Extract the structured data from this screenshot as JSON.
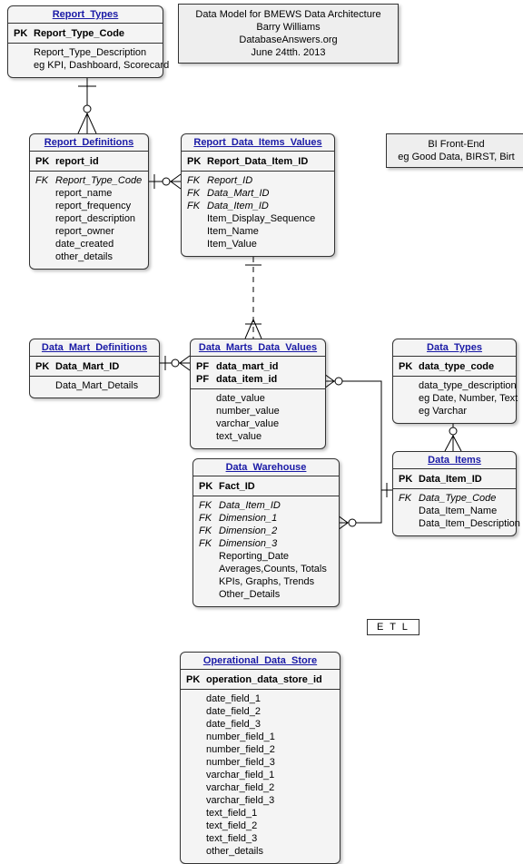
{
  "header_note": {
    "line1": "Data Model for BMEWS Data Architecture",
    "line2": "Barry Williams",
    "line3": "DatabaseAnswers.org",
    "line4": "June 24tth. 2013"
  },
  "side_note": {
    "line1": "BI Front-End",
    "line2": "eg Good Data, BIRST, Birt"
  },
  "etl_label": "E T L",
  "entities": {
    "report_types": {
      "title": "Report_Types",
      "pk": "Report_Type_Code",
      "f1": "Report_Type_Description",
      "f2": "eg KPI, Dashboard, Scorecard"
    },
    "report_definitions": {
      "title": "Report_Definitions",
      "pk": "report_id",
      "fk1": "Report_Type_Code",
      "f1": "report_name",
      "f2": "report_frequency",
      "f3": "report_description",
      "f4": "report_owner",
      "f5": "date_created",
      "f6": "other_details"
    },
    "report_data_items_values": {
      "title": "Report_Data_Items_Values",
      "pk": "Report_Data_Item_ID",
      "fk1": "Report_ID",
      "fk2": "Data_Mart_ID",
      "fk3": "Data_Item_ID",
      "f1": "Item_Display_Sequence",
      "f2": "Item_Name",
      "f3": "Item_Value"
    },
    "data_mart_definitions": {
      "title": "Data_Mart_Definitions",
      "pk": "Data_Mart_ID",
      "f1": "Data_Mart_Details"
    },
    "data_marts_data_values": {
      "title": "Data_Marts_Data_Values",
      "pf1": "data_mart_id",
      "pf2": "data_item_id",
      "f1": "date_value",
      "f2": "number_value",
      "f3": "varchar_value",
      "f4": "text_value"
    },
    "data_types": {
      "title": "Data_Types",
      "pk": "data_type_code",
      "f1": "data_type_description",
      "f2": "eg Date, Number, Text",
      "f3": "eg Varchar"
    },
    "data_items": {
      "title": "Data_Items",
      "pk": "Data_Item_ID",
      "fk1": "Data_Type_Code",
      "f1": "Data_Item_Name",
      "f2": "Data_Item_Description"
    },
    "data_warehouse": {
      "title": "Data_Warehouse",
      "pk": "Fact_ID",
      "fk1": "Data_Item_ID",
      "fk2": "Dimension_1",
      "fk3": "Dimension_2",
      "fk4": "Dimension_3",
      "f1": "Reporting_Date",
      "f2": "Averages,Counts, Totals",
      "f3": "KPIs, Graphs, Trends",
      "f4": "Other_Details"
    },
    "operational_data_store": {
      "title": "Operational_Data_Store",
      "pk": "operation_data_store_id",
      "f1": "date_field_1",
      "f2": "date_field_2",
      "f3": "date_field_3",
      "f4": "number_field_1",
      "f5": "number_field_2",
      "f6": "number_field_3",
      "f7": "varchar_field_1",
      "f8": "varchar_field_2",
      "f9": "varchar_field_3",
      "f10": "text_field_1",
      "f11": "text_field_2",
      "f12": "text_field_3",
      "f13": "other_details"
    }
  }
}
